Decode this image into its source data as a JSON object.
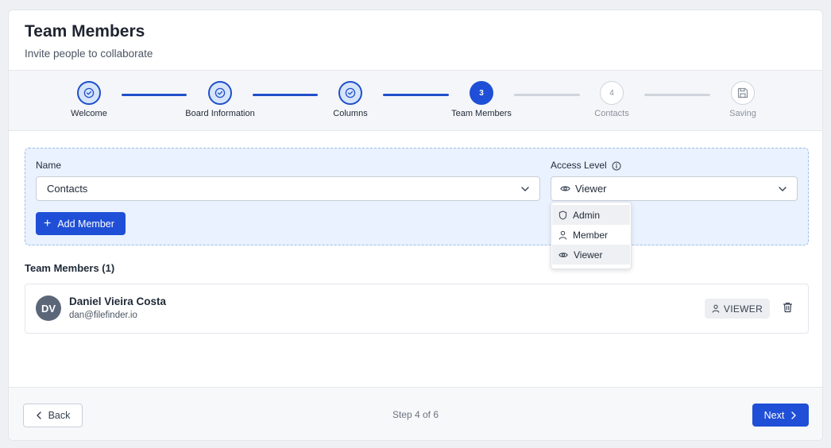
{
  "header": {
    "title": "Team Members",
    "subtitle": "Invite people to collaborate"
  },
  "stepper": {
    "steps": [
      {
        "label": "Welcome",
        "status": "done",
        "icon": "check-icon"
      },
      {
        "label": "Board Information",
        "status": "done",
        "icon": "check-icon"
      },
      {
        "label": "Columns",
        "status": "done",
        "icon": "check-icon"
      },
      {
        "label": "Team Members",
        "status": "active",
        "number": "3"
      },
      {
        "label": "Contacts",
        "status": "future",
        "number": "4"
      },
      {
        "label": "Saving",
        "status": "future",
        "icon": "save-icon"
      }
    ]
  },
  "form": {
    "name_label": "Name",
    "name_value": "Contacts",
    "access_label": "Access Level",
    "access_value": "Viewer",
    "add_button": "Add Member"
  },
  "access_dropdown": {
    "options": [
      {
        "label": "Admin",
        "icon": "shield-icon"
      },
      {
        "label": "Member",
        "icon": "user-icon"
      },
      {
        "label": "Viewer",
        "icon": "eye-icon"
      }
    ]
  },
  "members": {
    "heading": "Team Members (1)",
    "list": [
      {
        "initials": "DV",
        "name": "Daniel Vieira Costa",
        "email": "dan@filefinder.io",
        "role": "VIEWER"
      }
    ]
  },
  "footer": {
    "back": "Back",
    "step_counter": "Step 4 of 6",
    "next": "Next"
  },
  "colors": {
    "primary": "#1f4fd6",
    "panel_bg": "#e9f2fe",
    "done_circle": "#d6e4fb"
  }
}
